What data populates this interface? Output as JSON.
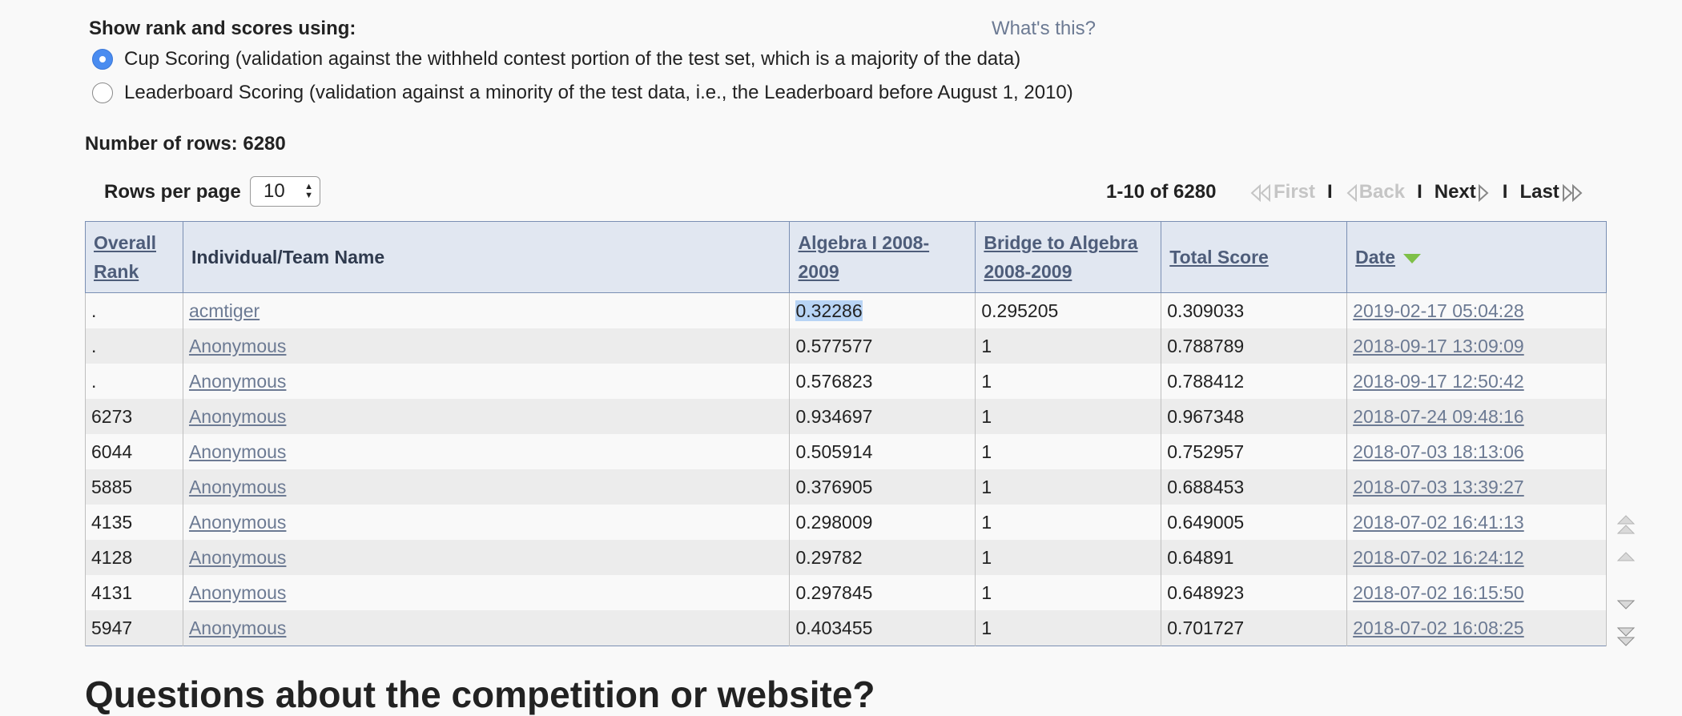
{
  "header": {
    "title": "Show rank and scores using:",
    "whats_this": "What's this?"
  },
  "scoring_options": [
    {
      "label": "Cup Scoring (validation against the withheld contest portion of the test set, which is a majority of the data)",
      "selected": true
    },
    {
      "label": "Leaderboard Scoring (validation against a minority of the test data, i.e., the Leaderboard before August 1, 2010)",
      "selected": false
    }
  ],
  "rows_count": "Number of rows: 6280",
  "rows_per_page": {
    "label": "Rows per page",
    "value": "10"
  },
  "pager": {
    "range": "1-10 of 6280",
    "first": "First",
    "back": "Back",
    "next": "Next",
    "last": "Last",
    "sep": "I"
  },
  "table": {
    "headers": {
      "rank": "Overall Rank",
      "name": "Individual/Team Name",
      "alg": "Algebra I 2008-2009",
      "bridge": "Bridge to Algebra 2008-2009",
      "total": "Total Score",
      "date": "Date"
    },
    "rows": [
      {
        "rank": ".",
        "name": "acmtiger",
        "alg": "0.32286",
        "bridge": "0.295205",
        "total": "0.309033",
        "date": "2019-02-17 05:04:28"
      },
      {
        "rank": ".",
        "name": "Anonymous",
        "alg": "0.577577",
        "bridge": "1",
        "total": "0.788789",
        "date": "2018-09-17 13:09:09"
      },
      {
        "rank": ".",
        "name": "Anonymous",
        "alg": "0.576823",
        "bridge": "1",
        "total": "0.788412",
        "date": "2018-09-17 12:50:42"
      },
      {
        "rank": "6273",
        "name": "Anonymous",
        "alg": "0.934697",
        "bridge": "1",
        "total": "0.967348",
        "date": "2018-07-24 09:48:16"
      },
      {
        "rank": "6044",
        "name": "Anonymous",
        "alg": "0.505914",
        "bridge": "1",
        "total": "0.752957",
        "date": "2018-07-03 18:13:06"
      },
      {
        "rank": "5885",
        "name": "Anonymous",
        "alg": "0.376905",
        "bridge": "1",
        "total": "0.688453",
        "date": "2018-07-03 13:39:27"
      },
      {
        "rank": "4135",
        "name": "Anonymous",
        "alg": "0.298009",
        "bridge": "1",
        "total": "0.649005",
        "date": "2018-07-02 16:41:13"
      },
      {
        "rank": "4128",
        "name": "Anonymous",
        "alg": "0.29782",
        "bridge": "1",
        "total": "0.64891",
        "date": "2018-07-02 16:24:12"
      },
      {
        "rank": "4131",
        "name": "Anonymous",
        "alg": "0.297845",
        "bridge": "1",
        "total": "0.648923",
        "date": "2018-07-02 16:15:50"
      },
      {
        "rank": "5947",
        "name": "Anonymous",
        "alg": "0.403455",
        "bridge": "1",
        "total": "0.701727",
        "date": "2018-07-02 16:08:25"
      }
    ]
  },
  "colors": {
    "accent_radio": "#4a8cf0",
    "sort_arrow": "#7ec048",
    "link": "#6c7a93"
  },
  "bottom_heading": "Questions about the competition or website?"
}
